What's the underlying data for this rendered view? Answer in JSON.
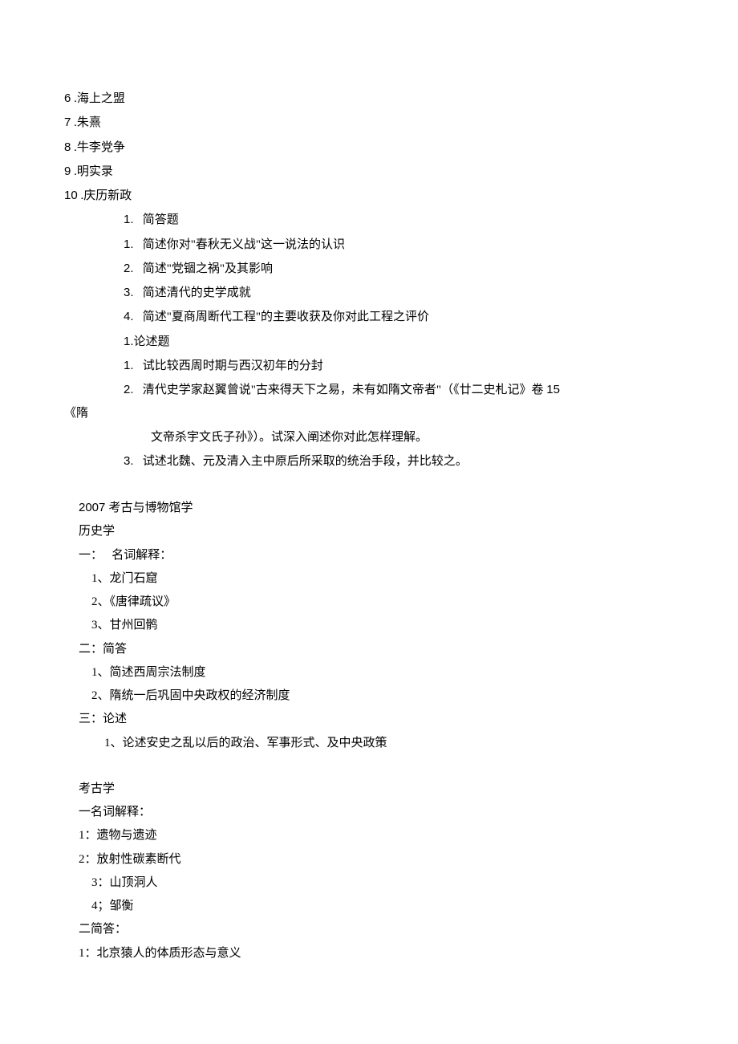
{
  "listA": [
    {
      "n": "6",
      "t": " .海上之盟"
    },
    {
      "n": "7",
      "t": " .朱熹"
    },
    {
      "n": "8",
      "t": " .牛李党争"
    },
    {
      "n": "9",
      "t": " .明实录"
    },
    {
      "n": "10",
      "t": " .庆历新政"
    }
  ],
  "groupB": {
    "header": {
      "n": "1.",
      "t": "   简答题"
    },
    "items": [
      {
        "n": "1.",
        "t": "   简述你对\"春秋无义战\"这一说法的认识"
      },
      {
        "n": "2.",
        "t": "   简述\"党锢之祸\"及其影响"
      },
      {
        "n": "3.",
        "t": "   简述清代的史学成就"
      },
      {
        "n": "4.",
        "t": "   简述\"夏商周断代工程\"的主要收获及你对此工程之评价"
      }
    ]
  },
  "groupC": {
    "header": {
      "n": "1.",
      "t": "论述题"
    },
    "items": [
      {
        "n": "1.",
        "t": "   试比较西周时期与西汉初年的分封"
      },
      {
        "n": "2.",
        "t": "   清代史学家赵翼曾说\"古来得天下之易，未有如隋文帝者\"（《廿二史札记》卷 ",
        "tail_n": "15"
      },
      {
        "cont_pre": "《隋"
      },
      {
        "cont": "文帝杀宇文氏子孙》）。试深入阐述你对此怎样理解。"
      },
      {
        "n": "3.",
        "t": "   试述北魏、元及清入主中原后所采取的统治手段，并比较之。"
      }
    ]
  },
  "sec2007": {
    "title_pre_n": "2007 ",
    "title": "考古与博物馆学",
    "history": {
      "label": "历史学",
      "h1": "一：   名词解释：",
      "terms": [
        "1、龙门石窟",
        "2、《唐律疏议》",
        "3、甘州回鹘"
      ],
      "h2": "二：简答",
      "shortans": [
        "1、简述西周宗法制度",
        "2、隋统一后巩固中央政权的经济制度"
      ],
      "h3": "三：论述",
      "essay": "1、论述安史之乱以后的政治、军事形式、及中央政策"
    },
    "arch": {
      "label": "考古学",
      "h1": "一名词解释：",
      "terms": [
        "1：遗物与遗迹",
        "2：放射性碳素断代",
        "3：山顶洞人",
        "4；邹衡"
      ],
      "h2": "二简答：",
      "shortans": [
        "1：北京猿人的体质形态与意义"
      ]
    }
  }
}
